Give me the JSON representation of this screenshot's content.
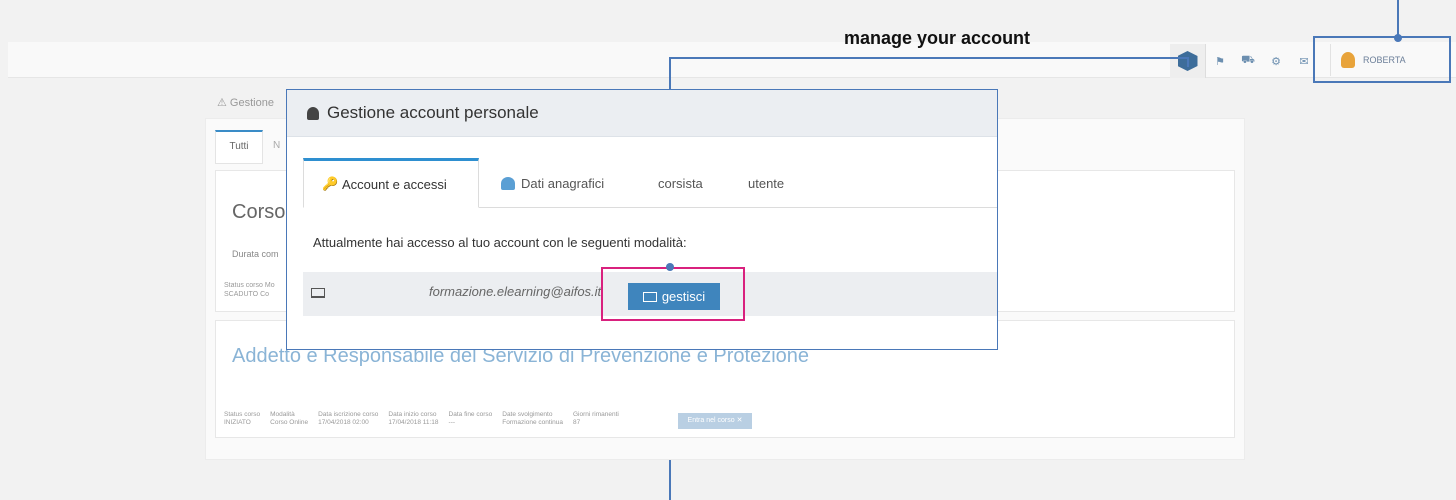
{
  "annotation": {
    "title": "manage your account"
  },
  "topbar": {
    "user_name": "ROBERTA",
    "icons": [
      "app-cube-icon",
      "flag-icon",
      "cart-icon",
      "gear-icon",
      "mail-icon"
    ]
  },
  "page": {
    "breadcrumb": "Gestione",
    "tabs": {
      "tutti": "Tutti",
      "n": "N"
    },
    "card1": {
      "title": "Corso",
      "durata": "Durata com",
      "status_label": "Status corso",
      "status": "SCADUTO",
      "mod_label": "Mo",
      "mod_value": "Co"
    },
    "card2": {
      "title": "Addetto e Responsabile del Servizio di Prevenzione e Protezione",
      "meta": [
        {
          "label": "Status corso",
          "value": "INIZIATO"
        },
        {
          "label": "Modalità",
          "value": "Corso Online"
        },
        {
          "label": "Data iscrizione corso",
          "value": "17/04/2018 02:00"
        },
        {
          "label": "Data inizio corso",
          "value": "17/04/2018 11:18"
        },
        {
          "label": "Data fine corso",
          "value": "---"
        },
        {
          "label": "Date svolgimento",
          "value": "Formazione continua"
        },
        {
          "label": "Giorni rimanenti",
          "value": "87"
        }
      ],
      "enter_button": "Entra nel corso ✕"
    }
  },
  "modal": {
    "title": "Gestione account personale",
    "tabs": [
      "Account e accessi",
      "Dati anagrafici",
      "corsista",
      "utente"
    ],
    "access_text": "Attualmente hai accesso al tuo account con le seguenti modalità:",
    "email": "formazione.elearning@aifos.it",
    "manage_button": "gestisci"
  }
}
